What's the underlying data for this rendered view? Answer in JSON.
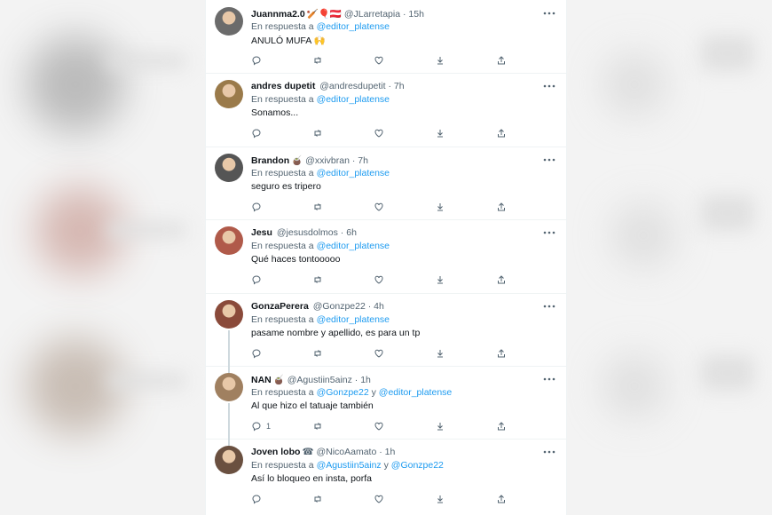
{
  "tweets": [
    {
      "name": "Juannma2.0",
      "emojis": "🏏🎈🇦🇹",
      "handle": "@JLarretapia",
      "time": "15h",
      "reply_prefix": "En respuesta a",
      "mentions": [
        "@editor_platense"
      ],
      "text": "ANULÓ MUFA 🙌",
      "reply_count": "",
      "avatar_color": "#6b6b6b"
    },
    {
      "name": "andres dupetit",
      "emojis": "",
      "handle": "@andresdupetit",
      "time": "7h",
      "reply_prefix": "En respuesta a",
      "mentions": [
        "@editor_platense"
      ],
      "text": "Sonamos...",
      "reply_count": "",
      "avatar_color": "#9a7a4a"
    },
    {
      "name": "Brandon",
      "emojis": "🧉",
      "handle": "@xxivbran",
      "time": "7h",
      "reply_prefix": "En respuesta a",
      "mentions": [
        "@editor_platense"
      ],
      "text": "seguro es tripero",
      "reply_count": "",
      "avatar_color": "#555555"
    },
    {
      "name": "Jesu",
      "emojis": "",
      "handle": "@jesusdolmos",
      "time": "6h",
      "reply_prefix": "En respuesta a",
      "mentions": [
        "@editor_platense"
      ],
      "text": "Qué haces tontooooo",
      "reply_count": "",
      "avatar_color": "#b05a4a"
    },
    {
      "name": "GonzaPerera",
      "emojis": "",
      "handle": "@Gonzpe22",
      "time": "4h",
      "reply_prefix": "En respuesta a",
      "mentions": [
        "@editor_platense"
      ],
      "text": "pasame nombre y apellido, es para un tp",
      "reply_count": "",
      "avatar_color": "#8a4a3a"
    },
    {
      "name": "NAN",
      "emojis": "🧉",
      "handle": "@Agustiin5ainz",
      "time": "1h",
      "reply_prefix": "En respuesta a",
      "mentions": [
        "@Gonzpe22",
        "@editor_platense"
      ],
      "mention_joiner": "y",
      "text": "Al que hizo el tatuaje también",
      "reply_count": "1",
      "avatar_color": "#a08060"
    },
    {
      "name": "Joven lobo",
      "emojis": "☎",
      "handle": "@NicoAamato",
      "time": "1h",
      "reply_prefix": "En respuesta a",
      "mentions": [
        "@Agustiin5ainz",
        "@Gonzpe22"
      ],
      "mention_joiner": "y",
      "text": "Así lo bloqueo en insta, porfa",
      "reply_count": "",
      "avatar_color": "#6a5040"
    }
  ],
  "colors": {
    "link": "#1d9bf0",
    "secondary_text": "#536471",
    "primary_text": "#0f1419"
  }
}
